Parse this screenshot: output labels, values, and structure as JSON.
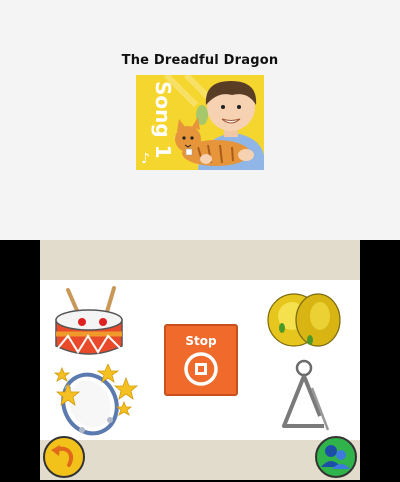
{
  "top_screen": {
    "song_title": "The Dreadful Dragon",
    "cover_label": "Song 1"
  },
  "controls": {
    "stop_label": "Stop"
  },
  "instruments": [
    "drum",
    "cymbals",
    "tambourine",
    "triangle"
  ],
  "colors": {
    "stop_button": "#f06a2c",
    "band": "#e2dccd",
    "cover_yellow": "#f5d62e",
    "back_button": "#f2c21a",
    "friends_button": "#2fb34a"
  }
}
